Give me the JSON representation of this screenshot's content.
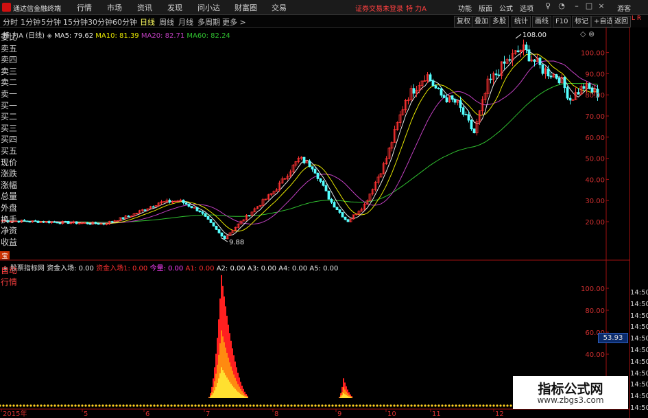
{
  "app": {
    "title": "通达信金融终端"
  },
  "menu": [
    {
      "label": "行情"
    },
    {
      "label": "市场"
    },
    {
      "label": "资讯"
    },
    {
      "label": "发现"
    },
    {
      "label": "问小达"
    },
    {
      "label": "财富圈"
    },
    {
      "label": "交易"
    }
  ],
  "status": {
    "login_warning": "证券交易未登录",
    "stock_title": "特 力A"
  },
  "menu_right": [
    {
      "label": "功能"
    },
    {
      "label": "版面"
    },
    {
      "label": "公式"
    },
    {
      "label": "选项"
    }
  ],
  "guest_label": "游客",
  "periods": [
    {
      "label": "分时"
    },
    {
      "label": "1分钟"
    },
    {
      "label": "5分钟"
    },
    {
      "label": "15分钟"
    },
    {
      "label": "30分钟"
    },
    {
      "label": "60分钟"
    },
    {
      "label": "日线",
      "active": true
    },
    {
      "label": "周线"
    },
    {
      "label": "月线"
    },
    {
      "label": "多周期"
    },
    {
      "label": "更多 >"
    }
  ],
  "tools": [
    {
      "label": "复权"
    },
    {
      "label": "叠加"
    },
    {
      "label": "多股"
    },
    {
      "label": "统计"
    },
    {
      "label": "画线"
    },
    {
      "label": "F10"
    },
    {
      "label": "标记"
    },
    {
      "label": "+自选"
    },
    {
      "label": "返回"
    }
  ],
  "ma_legend": {
    "name": "特 力A (日线)",
    "ma5": "MA5: 79.62",
    "ma10": "MA10: 81.39",
    "ma20": "MA20: 82.71",
    "ma60": "MA60: 82.24",
    "colors": {
      "ma5": "#e8e8e8",
      "ma10": "#e6e600",
      "ma20": "#c040c0",
      "ma60": "#30c030"
    }
  },
  "price_axis": [
    "100.00",
    "90.00",
    "80.00",
    "70.00",
    "60.00",
    "50.00",
    "40.00",
    "30.00",
    "20.00"
  ],
  "annotations": {
    "high": "108.00",
    "low": "9.88"
  },
  "subchart": {
    "name": "股票指标网",
    "items": [
      {
        "label": "资金入场: 0.00",
        "color": "#e8e8e8"
      },
      {
        "label": "资金入场1: 0.00",
        "color": "#ff3030"
      },
      {
        "label": "今量: 0.00",
        "color": "#ff40ff"
      },
      {
        "label": "A1: 0.00",
        "color": "#ff3030"
      },
      {
        "label": "A2: 0.00",
        "color": "#e8e8e8"
      },
      {
        "label": "A3: 0.00",
        "color": "#e8e8e8"
      },
      {
        "label": "A4: 0.00",
        "color": "#e8e8e8"
      },
      {
        "label": "A5: 0.00",
        "color": "#e8e8e8"
      }
    ],
    "axis": [
      "100.00",
      "80.00",
      "60.00",
      "40.00"
    ],
    "current_value": "53.93"
  },
  "date_axis": [
    "2015年",
    "5",
    "6",
    "7",
    "8",
    "9",
    "10",
    "11",
    "12"
  ],
  "right_panel": {
    "letters": "L R",
    "items": [
      "委比",
      "卖五",
      "卖四",
      "卖三",
      "卖二",
      "卖一",
      "买一",
      "买二",
      "买三",
      "买四",
      "买五",
      "现价",
      "涨跌",
      "涨幅",
      "总量",
      "外盘",
      "换手",
      "净资",
      "收益"
    ],
    "tabs": [
      "自动",
      "行情"
    ],
    "times": [
      "14:50",
      "14:50",
      "14:50",
      "14:50",
      "14:50",
      "14:50",
      "14:50",
      "14:50",
      "14:50",
      "14:50",
      "14:50"
    ]
  },
  "watermark": {
    "title": "指标公式网",
    "url": "www.zbgs3.com"
  },
  "corner_tag": "宝"
}
